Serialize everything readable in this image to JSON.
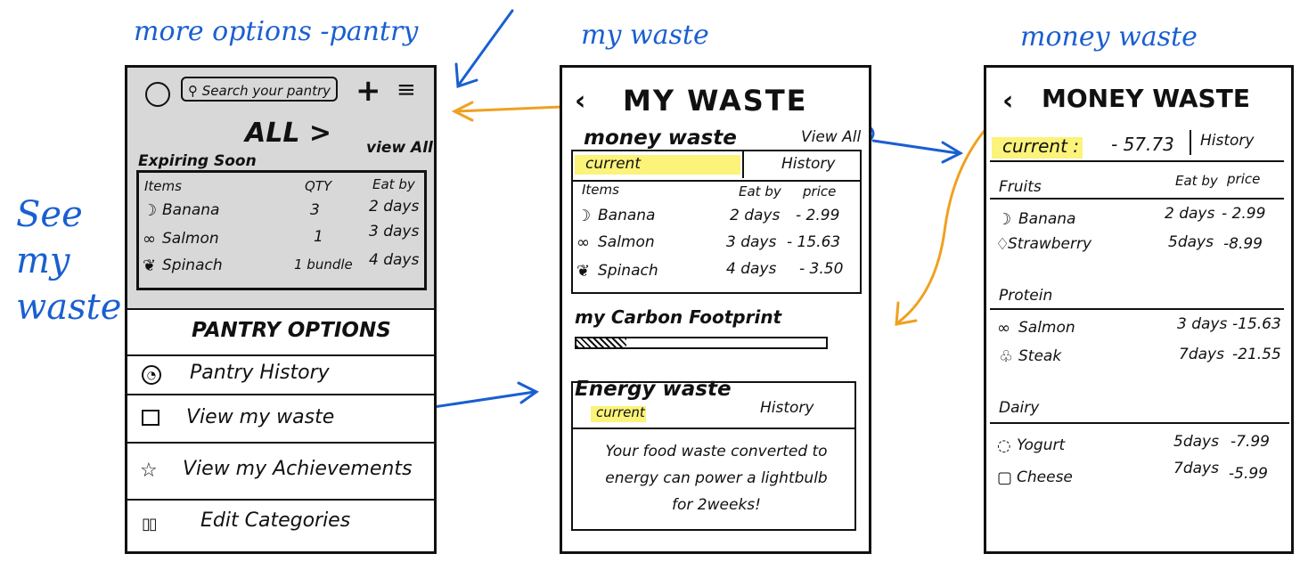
{
  "labels": {
    "pantry": "more options -pantry",
    "mywaste": "my waste",
    "money": "money waste",
    "side": [
      "See",
      "my",
      "waste"
    ]
  },
  "pantry": {
    "search_placeholder": "Search your pantry",
    "category": "ALL >",
    "expiring": "Expiring Soon",
    "view_all": "view All",
    "headers": [
      "Items",
      "QTY",
      "Eat by"
    ],
    "rows": [
      {
        "item": "Banana",
        "qty": "3",
        "eat_by": "2 days"
      },
      {
        "item": "Salmon",
        "qty": "1",
        "eat_by": "3 days"
      },
      {
        "item": "Spinach",
        "qty": "1 bundle",
        "eat_by": "4 days"
      }
    ],
    "options_title": "PANTRY OPTIONS",
    "options": [
      "Pantry History",
      "View my waste",
      "View my Achievements",
      "Edit Categories"
    ]
  },
  "mywaste": {
    "title": "MY WASTE",
    "money_heading": "money waste",
    "view_all": "View All",
    "tab_current": "current",
    "tab_history": "History",
    "headers": [
      "Items",
      "Eat by",
      "price"
    ],
    "rows": [
      {
        "item": "Banana",
        "eat_by": "2 days",
        "price": "- 2.99"
      },
      {
        "item": "Salmon",
        "eat_by": "3 days",
        "price": "- 15.63"
      },
      {
        "item": "Spinach",
        "eat_by": "4 days",
        "price": "- 3.50"
      }
    ],
    "carbon_heading": "my Carbon Footprint",
    "carbon_level": 0.2,
    "energy_heading": "Energy waste",
    "energy_current": "current",
    "energy_history": "History",
    "energy_msg": "Your food waste converted to energy can power a lightbulb for 2weeks!"
  },
  "money": {
    "title": "MONEY WASTE",
    "current": "current :",
    "current_value": "- 57.73",
    "history": "History",
    "sections": [
      {
        "name": "Fruits",
        "col1": "Eat by",
        "col2": "price",
        "rows": [
          {
            "item": "Banana",
            "eat_by": "2 days",
            "price": "- 2.99"
          },
          {
            "item": "Strawberry",
            "eat_by": "5days",
            "price": "-8.99"
          }
        ]
      },
      {
        "name": "Protein",
        "col1": "",
        "col2": "",
        "rows": [
          {
            "item": "Salmon",
            "eat_by": "3 days",
            "price": "-15.63"
          },
          {
            "item": "Steak",
            "eat_by": "7days",
            "price": "-21.55"
          }
        ]
      },
      {
        "name": "Dairy",
        "col1": "",
        "col2": "",
        "rows": [
          {
            "item": "Yogurt",
            "eat_by": "5days",
            "price": "-7.99"
          },
          {
            "item": "Cheese",
            "eat_by": "7days",
            "price": "-5.99"
          }
        ]
      }
    ]
  },
  "colors": {
    "annotation_blue": "#1a5fd0",
    "arrow_orange": "#f0a020",
    "highlight": "#fbf37a",
    "panel_gray": "#d8d8d8"
  }
}
